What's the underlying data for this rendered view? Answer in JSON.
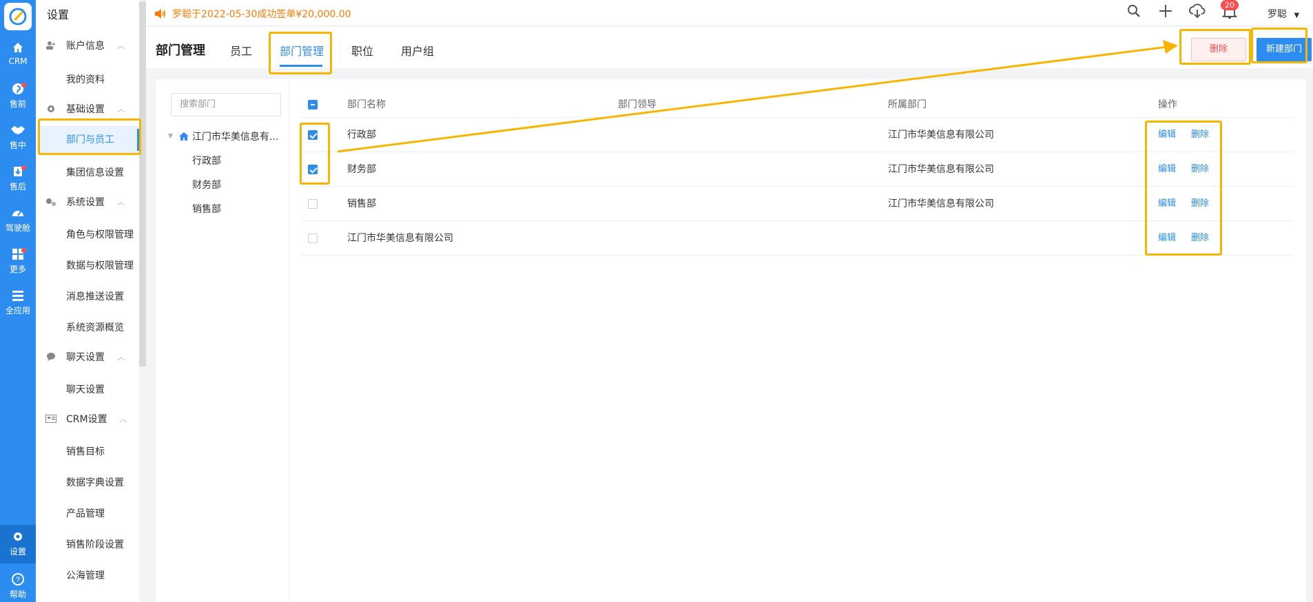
{
  "rail": {
    "items": [
      {
        "label": "CRM",
        "icon": "home-icon"
      },
      {
        "label": "售前",
        "icon": "pinterest-icon",
        "dot": true
      },
      {
        "label": "售中",
        "icon": "handshake-icon"
      },
      {
        "label": "售后",
        "icon": "tool-icon",
        "dot": true
      },
      {
        "label": "驾驶舱",
        "icon": "dashboard-icon"
      },
      {
        "label": "更多",
        "icon": "grid-icon",
        "dot": true
      },
      {
        "label": "全应用",
        "icon": "menu-icon"
      },
      {
        "label": "设置",
        "icon": "gear-icon"
      },
      {
        "label": "帮助",
        "icon": "help-icon"
      }
    ]
  },
  "sidebar": {
    "title": "设置",
    "groups": [
      {
        "label": "账户信息",
        "icon": "users-icon",
        "items": [
          "我的资料"
        ]
      },
      {
        "label": "基础设置",
        "icon": "gear-icon",
        "items": [
          "部门与员工",
          "集团信息设置"
        ]
      },
      {
        "label": "系统设置",
        "icon": "gears-icon",
        "items": [
          "角色与权限管理",
          "数据与权限管理",
          "消息推送设置",
          "系统资源概览"
        ]
      },
      {
        "label": "聊天设置",
        "icon": "chat-icon",
        "items": [
          "聊天设置"
        ]
      },
      {
        "label": "CRM设置",
        "icon": "card-icon",
        "items": [
          "销售目标",
          "数据字典设置",
          "产品管理",
          "销售阶段设置",
          "公海管理"
        ]
      }
    ]
  },
  "topbar": {
    "ticker": "罗聪于2022-05-30成功签单¥20,000.00",
    "badge": "20",
    "user": "罗聪"
  },
  "page": {
    "title": "部门管理",
    "tabs": [
      "员工",
      "部门管理",
      "职位",
      "用户组"
    ],
    "delete_label": "删除",
    "new_label": "新建部门"
  },
  "tree": {
    "search_placeholder": "搜索部门",
    "root": "江门市华美信息有...",
    "children": [
      "行政部",
      "财务部",
      "销售部"
    ]
  },
  "table": {
    "headers": [
      "部门名称",
      "部门领导",
      "所属部门",
      "操作"
    ],
    "rows": [
      {
        "name": "行政部",
        "leader": "",
        "parent": "江门市华美信息有限公司",
        "checked": true
      },
      {
        "name": "财务部",
        "leader": "",
        "parent": "江门市华美信息有限公司",
        "checked": true
      },
      {
        "name": "销售部",
        "leader": "",
        "parent": "江门市华美信息有限公司",
        "checked": false
      },
      {
        "name": "江门市华美信息有限公司",
        "leader": "",
        "parent": "",
        "checked": false
      }
    ],
    "edit_label": "编辑",
    "delete_label": "删除"
  },
  "colors": {
    "primary": "#2c8cf0",
    "highlight": "#f7b500",
    "ticker": "#ff7a00",
    "danger": "#ff4d4f"
  }
}
